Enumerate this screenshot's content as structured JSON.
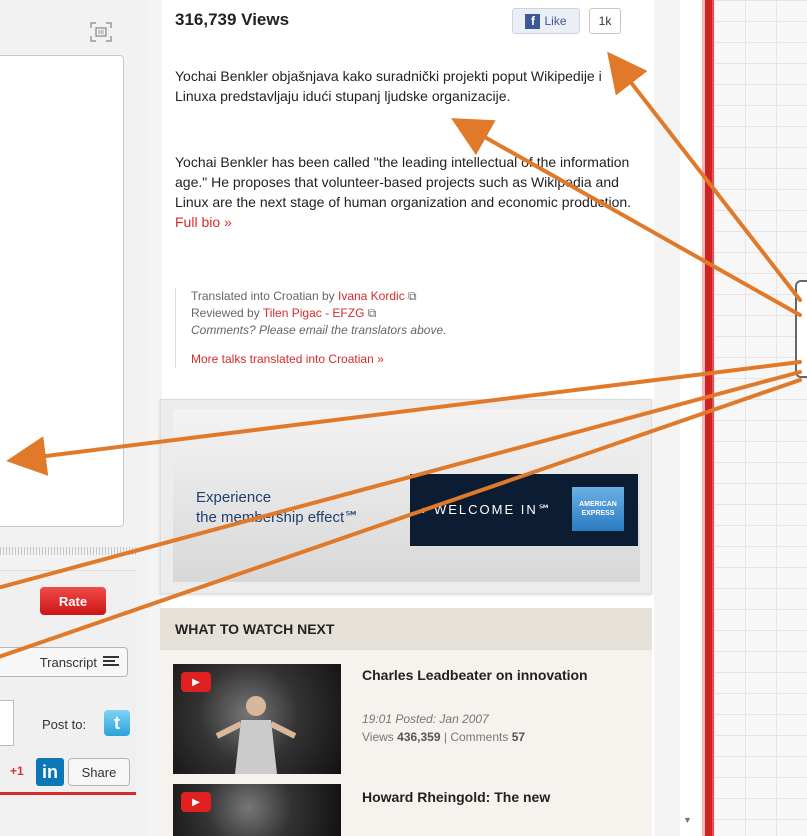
{
  "player": {
    "rate_label": "Rate",
    "transcript_label": "Transcript",
    "post_to_label": "Post to:",
    "twitter_glyph": "t",
    "gplus_label": "+1",
    "linkedin_glyph": "in",
    "share_label": "Share"
  },
  "talk": {
    "views": "316,739 Views",
    "fb_like_label": "Like",
    "fb_count": "1k",
    "description_hr": "Yochai Benkler objašnjava kako suradnički projekti poput Wikipedije i Linuxa predstavljaju idući stupanj ljudske organizacije.",
    "description_en": "Yochai Benkler has been called \"the leading intellectual of the information age.\" He proposes that volunteer-based projects such as Wikipedia and Linux are the next stage of human organization and economic production.",
    "full_bio_link": "Full bio »",
    "translated_prefix": "Translated into Croatian by",
    "translator": "Ivana Kordic",
    "reviewed_prefix": "Reviewed by",
    "reviewer": "Tilen Pigac - EFZG",
    "comments_note": "Comments? Please email the translators above.",
    "more_talks_link": "More talks translated into Croatian »"
  },
  "ad": {
    "line1": "Experience",
    "line2": "the membership effect℠",
    "cta": "› WELCOME IN℠",
    "logo_text": "AMERICAN EXPRESS"
  },
  "watch_next": {
    "header": "WHAT TO WATCH NEXT",
    "talks": [
      {
        "title": "Charles Leadbeater on innovation",
        "duration_posted": "19:01 Posted: Jan 2007",
        "views_label": "Views",
        "views": "436,359",
        "comments_label": "Comments",
        "comments": "57"
      },
      {
        "title": "Howard Rheingold: The new"
      }
    ]
  },
  "colors": {
    "accent_red": "#d62b2b",
    "arrow_orange": "#e07a2a",
    "facebook_blue": "#3b5998"
  }
}
